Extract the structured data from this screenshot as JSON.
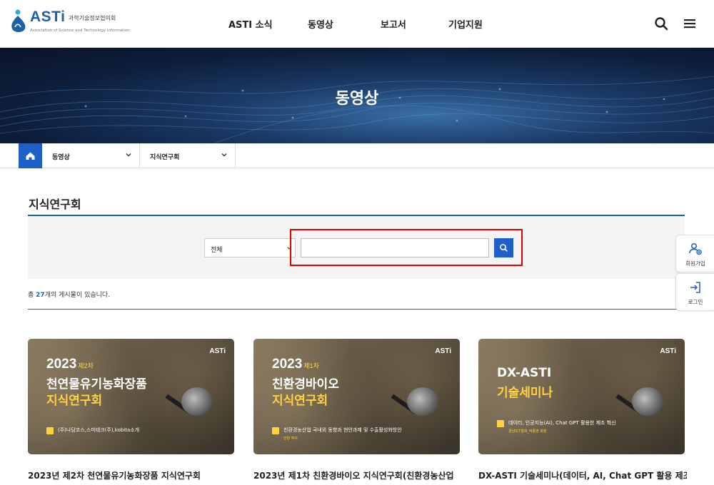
{
  "header": {
    "logo_text": "ASTi",
    "logo_kr": "과학기술정보협의회",
    "logo_en": "Association of Science and Technology Information",
    "nav": [
      "ASTI 소식",
      "동영상",
      "보고서",
      "기업지원"
    ],
    "search_icon": "search-icon",
    "menu_icon": "hamburger-menu-icon"
  },
  "banner": {
    "title": "동영상"
  },
  "location": {
    "home_icon": "home-icon",
    "depth1": "동영상",
    "depth2": "지식연구회"
  },
  "page": {
    "title": "지식연구회"
  },
  "search": {
    "select_value": "전체",
    "input_value": "",
    "input_placeholder": "",
    "button_icon": "search-icon"
  },
  "list": {
    "count_prefix": "총 ",
    "count": "27",
    "count_suffix": "개의 게시물이 있습니다."
  },
  "cards": [
    {
      "year": "2023",
      "round": "제2차",
      "line1": "천연물유기농화장품",
      "line2": "지식연구회",
      "brand": "ASTi",
      "desc": "(주)나담코스,스미테크(주),kobita소개",
      "sub": "",
      "title": "2023년 제2차 천연물유기농화장품 지식연구회"
    },
    {
      "year": "2023",
      "round": "제1차",
      "line1": "친환경바이오",
      "line2": "지식연구회",
      "brand": "ASTi",
      "desc": "친환경농산업 국내외 동향과 현안과제 및 수출활성화방안",
      "sub": "안양 박사",
      "title": "2023년 제1차 친환경바이오 지식연구회(친환경농산업"
    },
    {
      "year": "",
      "round": "",
      "line1": "DX-ASTI",
      "line2": "기술세미나",
      "brand": "ASTi",
      "desc": "데이터, 인공지능(AI), Chat GPT 활용한 제조 혁신",
      "sub": "경남ICT협회_박종영 회장",
      "title": "DX-ASTI 기술세미나(데이터, AI, Chat GPT 활용 제조"
    }
  ],
  "quick": [
    {
      "label": "회원가입",
      "icon": "user-add-icon"
    },
    {
      "label": "로그인",
      "icon": "login-icon"
    }
  ],
  "colors": {
    "primary": "#1f5fc8",
    "highlight": "#e00000",
    "accent_yellow": "#ffd23f"
  }
}
